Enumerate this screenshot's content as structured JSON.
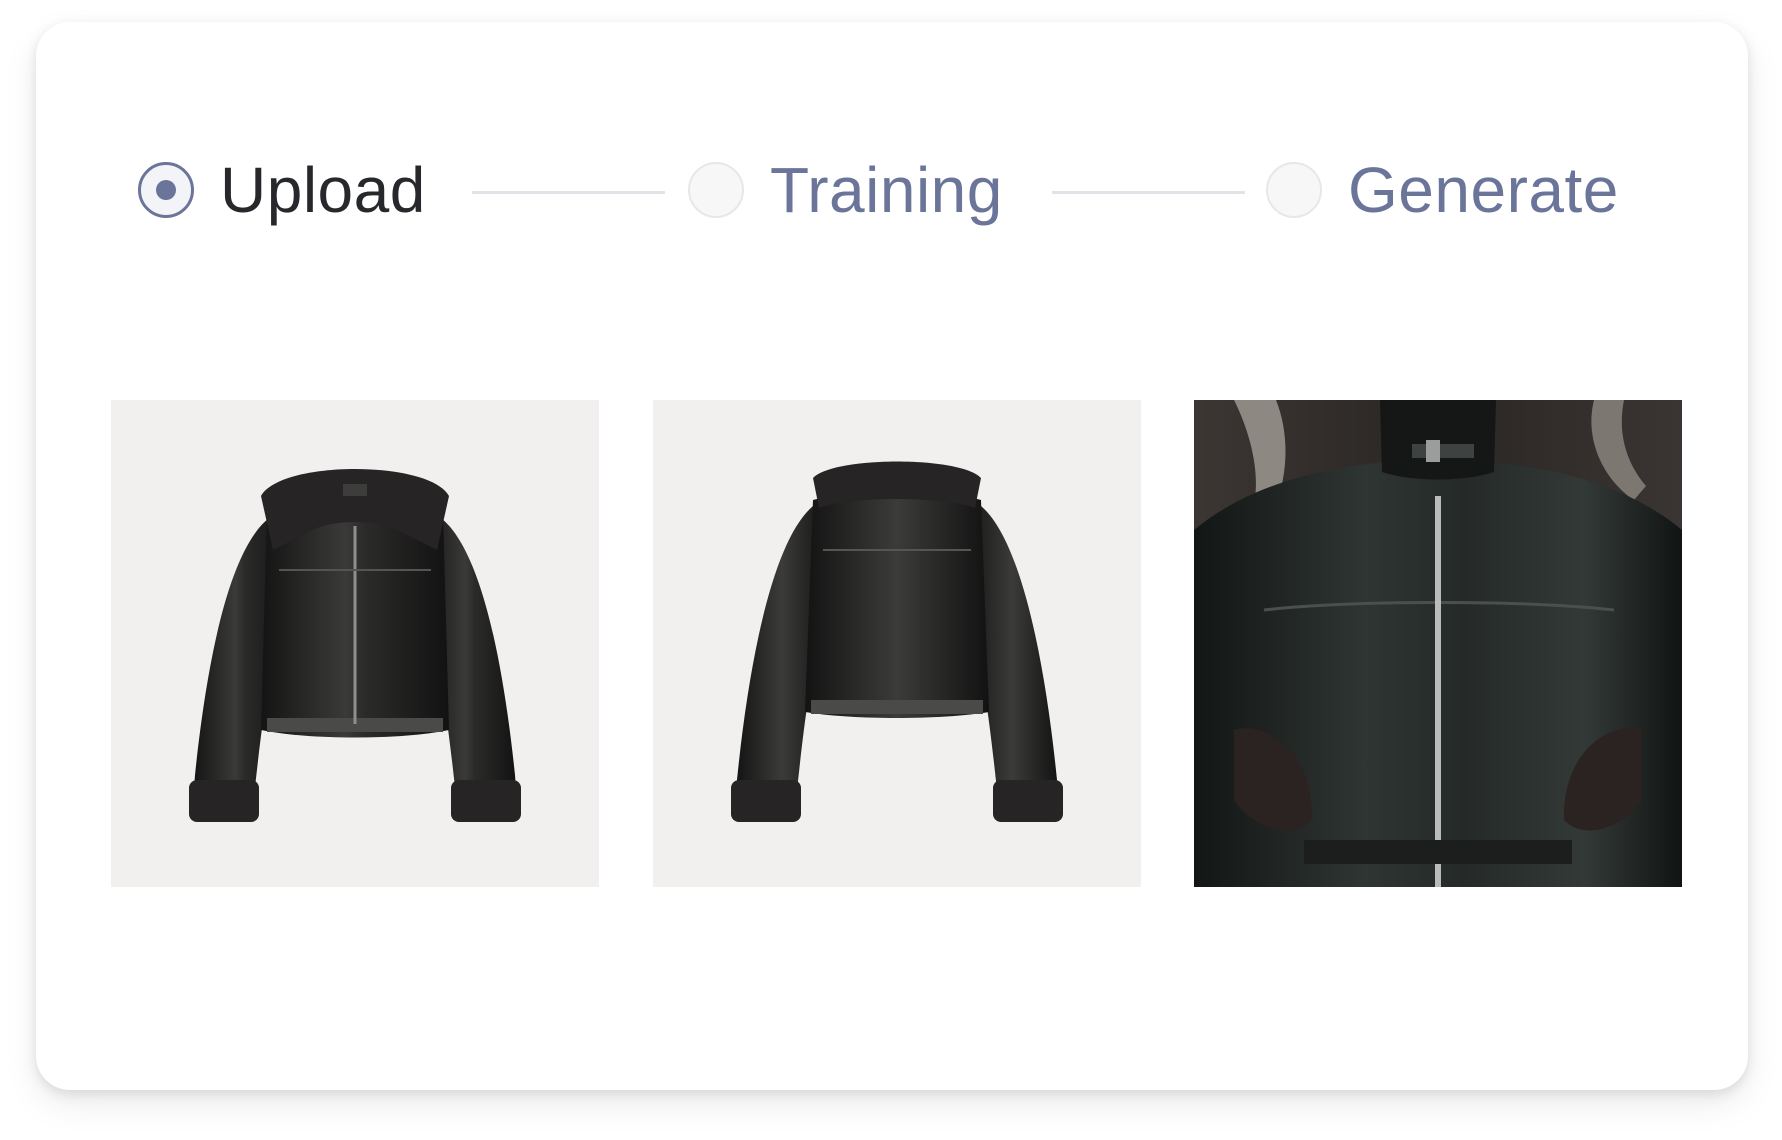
{
  "stepper": {
    "steps": [
      {
        "label": "Upload",
        "state": "active"
      },
      {
        "label": "Training",
        "state": "inactive"
      },
      {
        "label": "Generate",
        "state": "inactive"
      }
    ]
  },
  "images": [
    {
      "subject": "black leather shearling jacket front view",
      "background": "light-gray"
    },
    {
      "subject": "black leather shearling jacket back view",
      "background": "light-gray"
    },
    {
      "subject": "person wearing black leather shearling jacket",
      "background": "dark-street"
    }
  ],
  "colors": {
    "accent": "#6b7599",
    "active_text": "#27282c",
    "connector": "#e1e3e8",
    "product_background": "#f1f0ef"
  }
}
